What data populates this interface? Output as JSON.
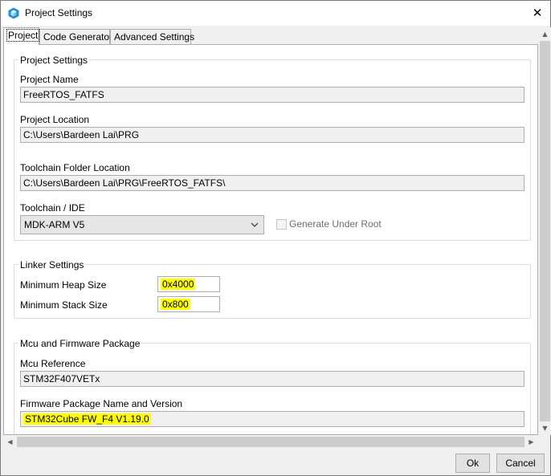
{
  "window": {
    "title": "Project Settings",
    "close_glyph": "✕"
  },
  "tabs": [
    {
      "label": "Project",
      "active": true
    },
    {
      "label": "Code Generator",
      "active": false
    },
    {
      "label": "Advanced Settings",
      "active": false
    }
  ],
  "project_settings": {
    "legend": "Project Settings",
    "project_name_label": "Project Name",
    "project_name_value": "FreeRTOS_FATFS",
    "project_location_label": "Project Location",
    "project_location_value": "C:\\Users\\Bardeen Lai\\PRG",
    "toolchain_folder_label": "Toolchain Folder Location",
    "toolchain_folder_value": "C:\\Users\\Bardeen Lai\\PRG\\FreeRTOS_FATFS\\",
    "toolchain_ide_label": "Toolchain / IDE",
    "toolchain_ide_value": "MDK-ARM V5",
    "generate_under_root_label": "Generate Under Root"
  },
  "linker_settings": {
    "legend": "Linker Settings",
    "min_heap_label": "Minimum Heap Size",
    "min_heap_value": "0x4000",
    "min_stack_label": "Minimum Stack Size",
    "min_stack_value": "0x800"
  },
  "mcu_firmware": {
    "legend": "Mcu and Firmware Package",
    "mcu_reference_label": "Mcu Reference",
    "mcu_reference_value": "STM32F407VETx",
    "firmware_label": "Firmware Package Name and Version",
    "firmware_value": "STM32Cube FW_F4 V1.19.0"
  },
  "footer": {
    "ok_label": "Ok",
    "cancel_label": "Cancel"
  },
  "icons": {
    "app": "cube-app-icon",
    "close": "close-icon",
    "dropdown": "chevron-down-icon"
  },
  "colors": {
    "highlight": "#ffff00",
    "accent": "#1e8fd8"
  }
}
